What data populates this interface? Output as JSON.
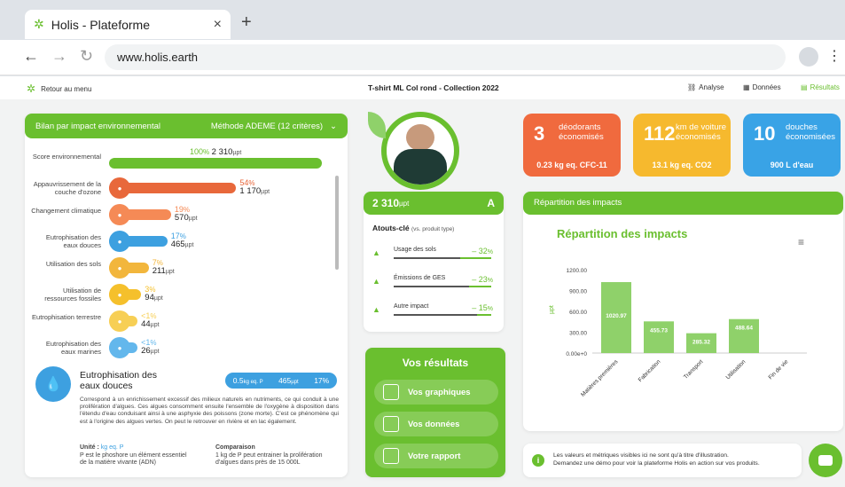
{
  "browser": {
    "tab_title": "Holis - Plateforme",
    "close": "×",
    "new_tab": "+",
    "url": "www.holis.earth",
    "back": "←",
    "forward": "→",
    "reload": "↻",
    "menu": "⋮"
  },
  "header": {
    "back_label": "Retour au menu",
    "title": "T-shirt ML Col rond - Collection 2022",
    "analyse": "Analyse",
    "donnees": "Données",
    "resultats": "Résultats"
  },
  "bilan": {
    "title": "Bilan par impact environnemental",
    "method": "Méthode ADEME (12 critères)",
    "score": {
      "label": "Score environnemental",
      "pct": "100",
      "pct_sign": "%",
      "value": "2 310",
      "unit": "µpt"
    },
    "rows": [
      {
        "label": "Appauvrissement de la couche d'ozone",
        "pct": "54",
        "value": "1 170",
        "color": "#e8683b",
        "fill": 0.54
      },
      {
        "label": "Changement climatique",
        "pct": "19",
        "value": "570",
        "color": "#f58a56",
        "fill": 0.19
      },
      {
        "label": "Eutrophisation des eaux douces",
        "pct": "17",
        "value": "465",
        "color": "#3da0e0",
        "fill": 0.17
      },
      {
        "label": "Utilisation des sols",
        "pct": "7",
        "value": "211",
        "color": "#f2b63c",
        "fill": 0.07
      },
      {
        "label": "Utilisation de ressources fossiles",
        "pct": "3",
        "value": "94",
        "color": "#f5c02c",
        "fill": 0.03
      },
      {
        "label": "Eutrophisation terrestre",
        "pct": "<1",
        "value": "44",
        "color": "#f7cf55",
        "fill": 0.01
      },
      {
        "label": "Eutrophisation des eaux marines",
        "pct": "<1",
        "value": "26",
        "color": "#63b7ec",
        "fill": 0.01
      }
    ]
  },
  "detail": {
    "title": "Eutrophisation des eaux douces",
    "badge_kg": "0.5",
    "badge_kg_unit": "kg eq. P",
    "badge_val": "465",
    "badge_unit": "µpt",
    "badge_pct": "17%",
    "desc": "Correspond à un enrichissement excessif des milieux naturels en nutriments, ce qui conduit à une prolifération d'algues. Ces algues consomment ensuite l'ensemble de l'oxygène à disposition dans l'étendu d'eau conduisant ainsi à une asphyxie des poissons (zone morte). C'est ce phénomène qui est à l'origine des algues vertes. On peut le retrouver en rivière et en lac également.",
    "unit_title": "Unité :",
    "unit_value": "kg eq. P",
    "unit_desc": "P est le phoshore un élément essentiel de la matière vivante (ADN)",
    "comp_title": "Comparaison",
    "comp_desc": "1 kg de P peut entrainer la prolifération d'algues dans près de 15 000L"
  },
  "product": {
    "score": "2 310",
    "unit": "µpt",
    "grade": "A",
    "atouts_title": "Atouts-clé",
    "atouts_sub": "(vs. produit type)",
    "atouts": [
      {
        "label": "Usage des sols",
        "value": "– 32",
        "fill": 0.68
      },
      {
        "label": "Émissions de GES",
        "value": "– 23",
        "fill": 0.77
      },
      {
        "label": "Autre impact",
        "value": "– 15",
        "fill": 0.85
      }
    ]
  },
  "results": {
    "title": "Vos résultats",
    "buttons": [
      "Vos graphiques",
      "Vos données",
      "Votre rapport"
    ]
  },
  "tiles": [
    {
      "num": "3",
      "label": "déodorants économisés",
      "sub": "0.23 kg eq. CFC-11",
      "color": "#f06a3e"
    },
    {
      "num": "112",
      "label": "km de voiture économisés",
      "sub": "13.1 kg eq. CO2",
      "color": "#f6b92e"
    },
    {
      "num": "10",
      "label": "douches économisées",
      "sub": "900 L d'eau",
      "color": "#39a3e6"
    }
  ],
  "repartition": {
    "header": "Répartition des impacts",
    "menu": "≡"
  },
  "chart_data": {
    "type": "bar",
    "title": "Répartition des impacts",
    "categories": [
      "Matières premières",
      "Fabrication",
      "Transport",
      "Utilisation",
      "Fin de vie"
    ],
    "values": [
      1020.97,
      455.73,
      285.32,
      488.64,
      0
    ],
    "value_labels": [
      "1020.97",
      "455.73",
      "285.32",
      "488.64",
      ""
    ],
    "yticks": [
      "1200.00",
      "900.00",
      "600.00",
      "300.00",
      "0.00e+0"
    ],
    "ylim": [
      0,
      1200
    ],
    "ylabel": "µpt",
    "color": "#8fd16a"
  },
  "footer": {
    "info": "Les valeurs et métriques visibles ici ne sont qu'à titre d'illustration.",
    "demo": "Demandez une démo pour voir la plateforme Holis en action sur vos produits."
  }
}
